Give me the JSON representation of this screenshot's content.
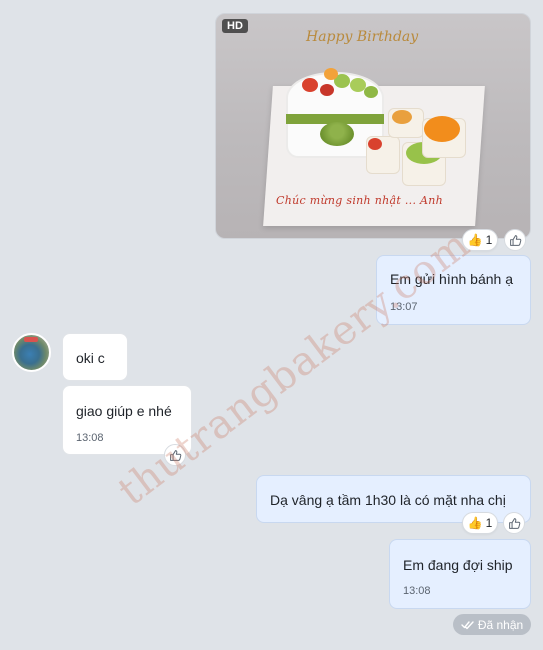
{
  "messages": {
    "photo": {
      "hd_badge": "HD",
      "topper_text": "Happy Birthday",
      "board_text": "Chúc mừng sinh nhật ... Anh",
      "reaction": {
        "emoji": "👍",
        "count": "1"
      }
    },
    "m1": {
      "text": "Em gửi hình bánh ạ",
      "time": "13:07"
    },
    "m2": {
      "text": "oki c"
    },
    "m3": {
      "text": "giao giúp e nhé",
      "time": "13:08"
    },
    "m4": {
      "text": "Dạ vâng ạ tầm 1h30 là có mặt nha chị",
      "reaction": {
        "emoji": "👍",
        "count": "1"
      }
    },
    "m5": {
      "text": "Em đang đợi ship",
      "time": "13:08"
    }
  },
  "status": {
    "label": "Đã nhận",
    "icon": "double-check-icon"
  },
  "watermark": "thutrangbakery.com",
  "colors": {
    "background": "#dfe3e8",
    "outgoing_bubble": "#e5efff",
    "incoming_bubble": "#ffffff",
    "status_chip": "#b9bfc7",
    "watermark": "#c97864"
  }
}
